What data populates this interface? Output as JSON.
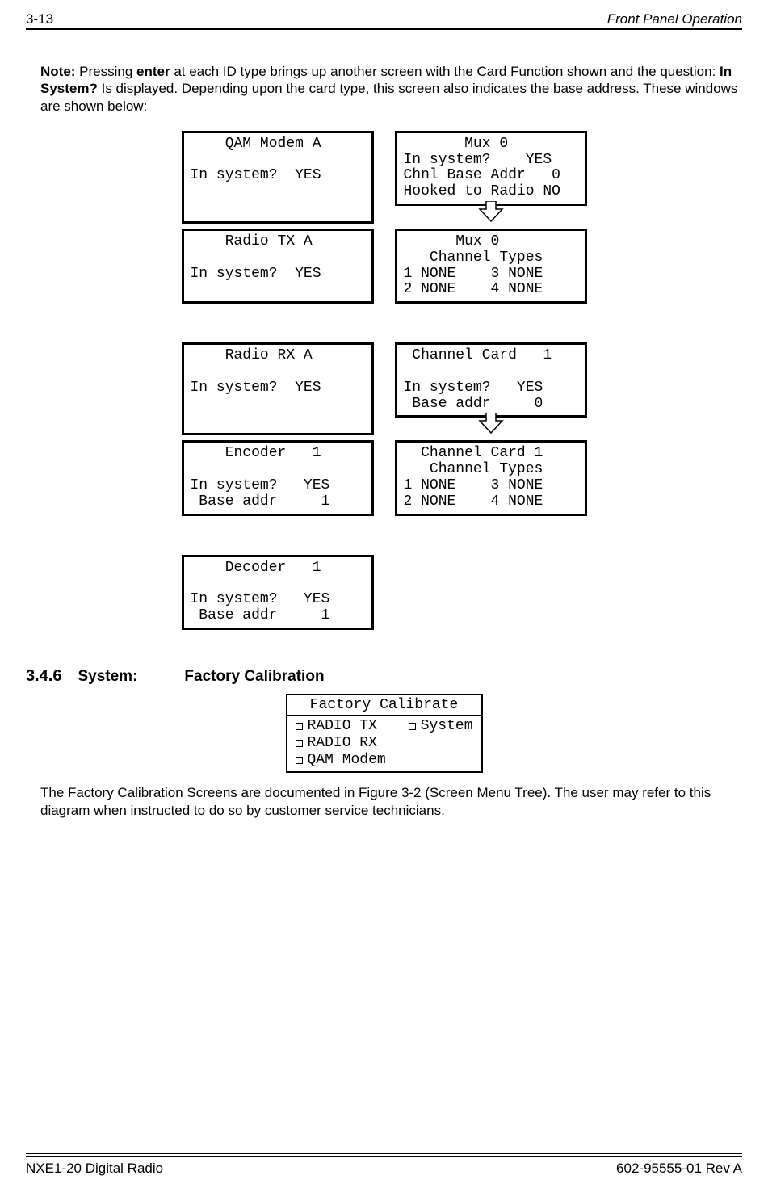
{
  "header": {
    "left": "3-13",
    "right": "Front Panel Operation"
  },
  "note": {
    "label": "Note:",
    "t1": "  Pressing ",
    "enter": "enter",
    "t2": " at each ID type brings up another screen with the Card Function shown and the question: ",
    "in_system": "In System?",
    "t3": " Is displayed.  Depending upon the card type, this screen also indicates the base address.  These windows are shown below:"
  },
  "lcd": {
    "qamA": "    QAM Modem A\n\nIn system?  YES",
    "mux0a": "       Mux 0\nIn system?    YES\nChnl Base Addr   0\nHooked to Radio NO",
    "radioTX": "    Radio TX A\n\nIn system?  YES",
    "mux0b": "      Mux 0\n   Channel Types\n1 NONE    3 NONE\n2 NONE    4 NONE",
    "radioRX": "    Radio RX A\n\nIn system?  YES",
    "chan1": " Channel Card   1\n\nIn system?   YES\n Base addr     0",
    "enc1": "    Encoder   1\n\nIn system?   YES\n Base addr     1",
    "chan1b": "  Channel Card 1\n   Channel Types\n1 NONE    3 NONE\n2 NONE    4 NONE",
    "dec1": "    Decoder   1\n\nIn system?   YES\n Base addr     1"
  },
  "section": {
    "num": "3.4.6",
    "system": "System:",
    "title": "Factory Calibration"
  },
  "fc": {
    "title": "Factory Calibrate",
    "items": [
      "RADIO TX",
      "RADIO RX",
      "QAM Modem"
    ],
    "right": "System"
  },
  "closing": "The Factory Calibration Screens are documented in Figure 3-2 (Screen Menu Tree).  The user may refer to this diagram when instructed to do so by customer service technicians.",
  "footer": {
    "left": "NXE1-20 Digital Radio",
    "right": "602-95555-01 Rev A"
  }
}
